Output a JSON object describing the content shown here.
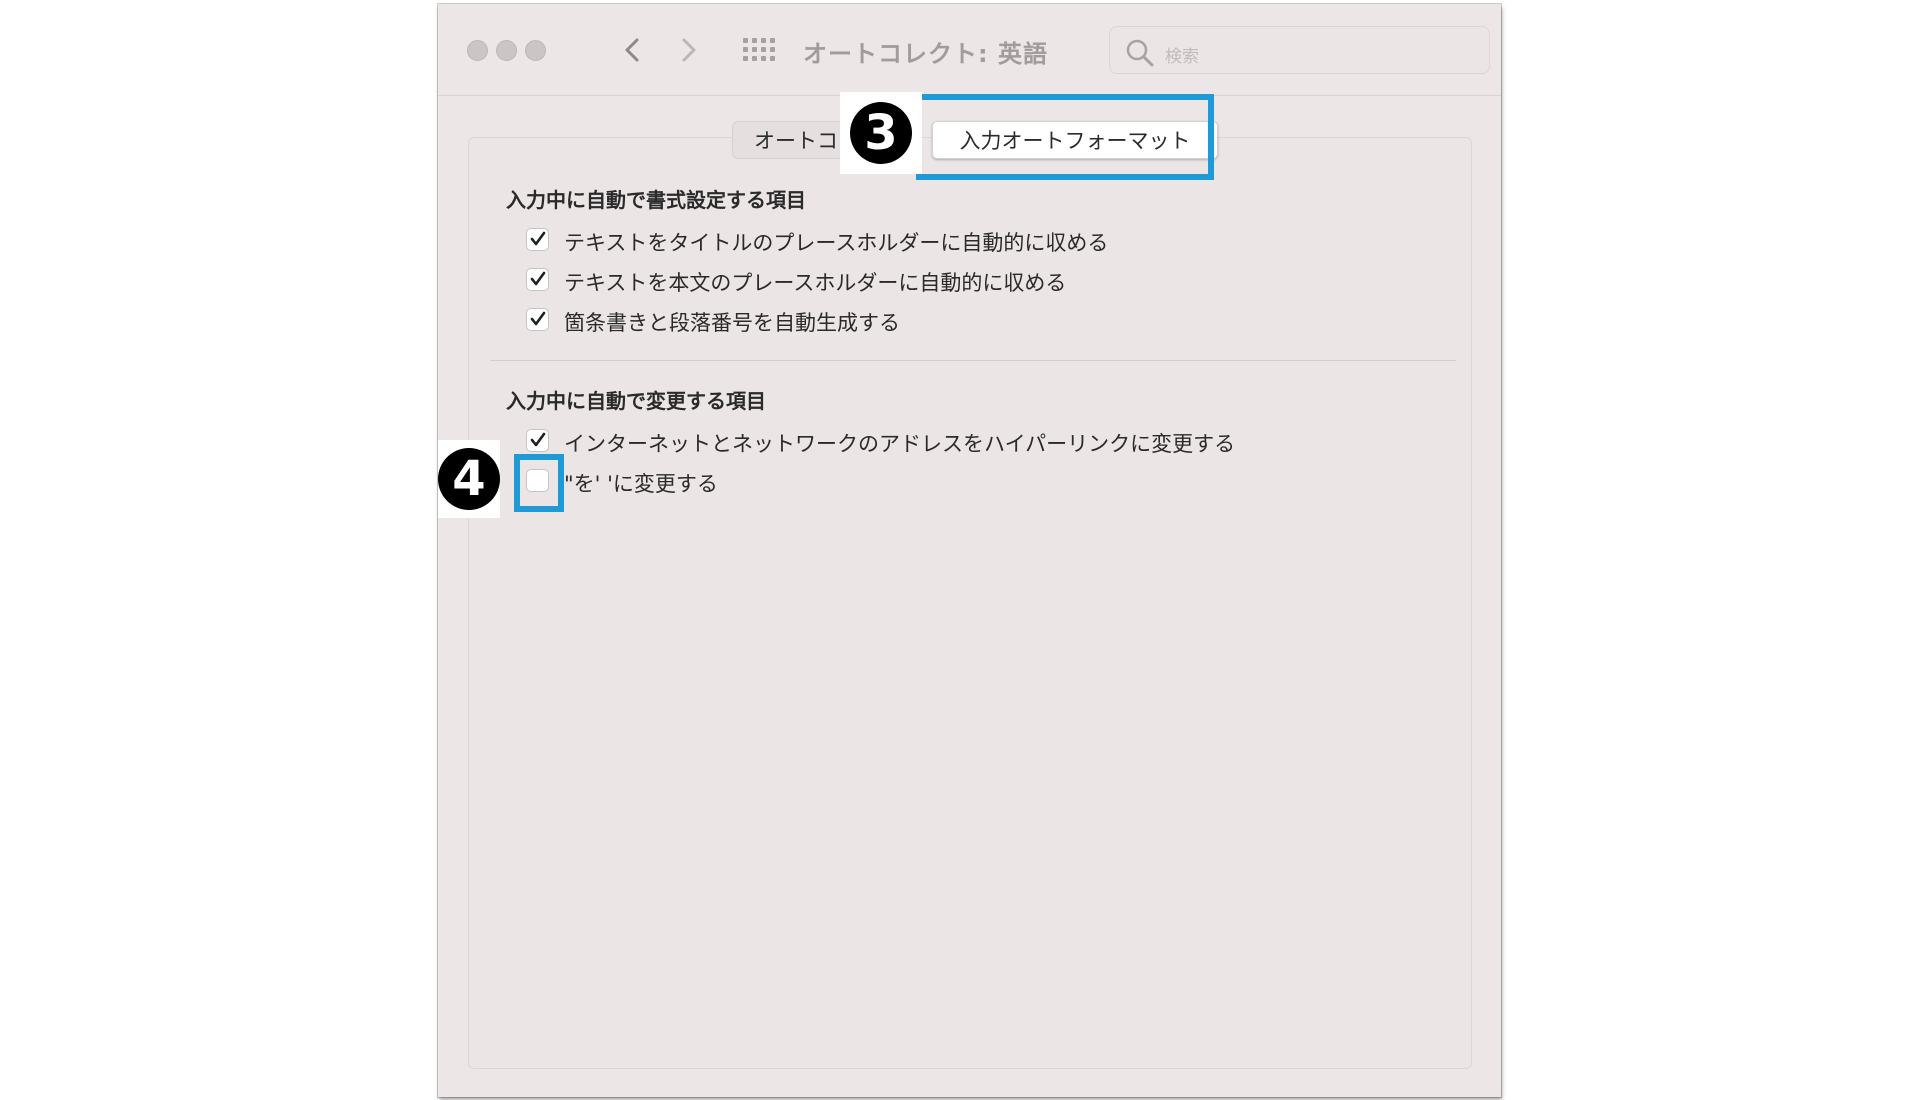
{
  "window": {
    "title": "オートコレクト: 英語",
    "search_placeholder": "検索"
  },
  "tabs": [
    {
      "label": "オートコレクト",
      "selected": false
    },
    {
      "label": "入力オートフォーマット",
      "selected": true
    }
  ],
  "annotations": {
    "step3": "3",
    "step4": "4",
    "highlight_color": "#1e9ad6"
  },
  "sections": [
    {
      "title": "入力中に自動で書式設定する項目",
      "options": [
        {
          "label": "テキストをタイトルのプレースホルダーに自動的に収める",
          "checked": true
        },
        {
          "label": "テキストを本文のプレースホルダーに自動的に収める",
          "checked": true
        },
        {
          "label": "箇条書きと段落番号を自動生成する",
          "checked": true
        }
      ]
    },
    {
      "title": "入力中に自動で変更する項目",
      "options": [
        {
          "label": "インターネットとネットワークのアドレスをハイパーリンクに変更する",
          "checked": true
        },
        {
          "label": "\"を' 'に変更する",
          "checked": false
        }
      ]
    }
  ]
}
